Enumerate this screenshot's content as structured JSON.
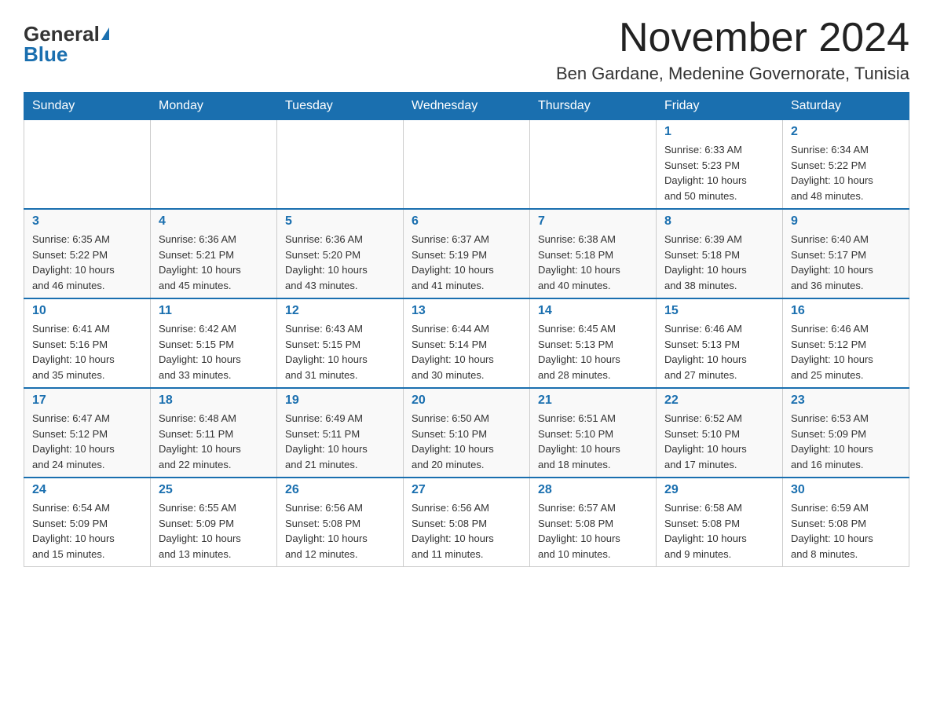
{
  "logo": {
    "general": "General",
    "blue": "Blue"
  },
  "title": "November 2024",
  "subtitle": "Ben Gardane, Medenine Governorate, Tunisia",
  "days_of_week": [
    "Sunday",
    "Monday",
    "Tuesday",
    "Wednesday",
    "Thursday",
    "Friday",
    "Saturday"
  ],
  "weeks": [
    [
      {
        "day": "",
        "info": ""
      },
      {
        "day": "",
        "info": ""
      },
      {
        "day": "",
        "info": ""
      },
      {
        "day": "",
        "info": ""
      },
      {
        "day": "",
        "info": ""
      },
      {
        "day": "1",
        "info": "Sunrise: 6:33 AM\nSunset: 5:23 PM\nDaylight: 10 hours\nand 50 minutes."
      },
      {
        "day": "2",
        "info": "Sunrise: 6:34 AM\nSunset: 5:22 PM\nDaylight: 10 hours\nand 48 minutes."
      }
    ],
    [
      {
        "day": "3",
        "info": "Sunrise: 6:35 AM\nSunset: 5:22 PM\nDaylight: 10 hours\nand 46 minutes."
      },
      {
        "day": "4",
        "info": "Sunrise: 6:36 AM\nSunset: 5:21 PM\nDaylight: 10 hours\nand 45 minutes."
      },
      {
        "day": "5",
        "info": "Sunrise: 6:36 AM\nSunset: 5:20 PM\nDaylight: 10 hours\nand 43 minutes."
      },
      {
        "day": "6",
        "info": "Sunrise: 6:37 AM\nSunset: 5:19 PM\nDaylight: 10 hours\nand 41 minutes."
      },
      {
        "day": "7",
        "info": "Sunrise: 6:38 AM\nSunset: 5:18 PM\nDaylight: 10 hours\nand 40 minutes."
      },
      {
        "day": "8",
        "info": "Sunrise: 6:39 AM\nSunset: 5:18 PM\nDaylight: 10 hours\nand 38 minutes."
      },
      {
        "day": "9",
        "info": "Sunrise: 6:40 AM\nSunset: 5:17 PM\nDaylight: 10 hours\nand 36 minutes."
      }
    ],
    [
      {
        "day": "10",
        "info": "Sunrise: 6:41 AM\nSunset: 5:16 PM\nDaylight: 10 hours\nand 35 minutes."
      },
      {
        "day": "11",
        "info": "Sunrise: 6:42 AM\nSunset: 5:15 PM\nDaylight: 10 hours\nand 33 minutes."
      },
      {
        "day": "12",
        "info": "Sunrise: 6:43 AM\nSunset: 5:15 PM\nDaylight: 10 hours\nand 31 minutes."
      },
      {
        "day": "13",
        "info": "Sunrise: 6:44 AM\nSunset: 5:14 PM\nDaylight: 10 hours\nand 30 minutes."
      },
      {
        "day": "14",
        "info": "Sunrise: 6:45 AM\nSunset: 5:13 PM\nDaylight: 10 hours\nand 28 minutes."
      },
      {
        "day": "15",
        "info": "Sunrise: 6:46 AM\nSunset: 5:13 PM\nDaylight: 10 hours\nand 27 minutes."
      },
      {
        "day": "16",
        "info": "Sunrise: 6:46 AM\nSunset: 5:12 PM\nDaylight: 10 hours\nand 25 minutes."
      }
    ],
    [
      {
        "day": "17",
        "info": "Sunrise: 6:47 AM\nSunset: 5:12 PM\nDaylight: 10 hours\nand 24 minutes."
      },
      {
        "day": "18",
        "info": "Sunrise: 6:48 AM\nSunset: 5:11 PM\nDaylight: 10 hours\nand 22 minutes."
      },
      {
        "day": "19",
        "info": "Sunrise: 6:49 AM\nSunset: 5:11 PM\nDaylight: 10 hours\nand 21 minutes."
      },
      {
        "day": "20",
        "info": "Sunrise: 6:50 AM\nSunset: 5:10 PM\nDaylight: 10 hours\nand 20 minutes."
      },
      {
        "day": "21",
        "info": "Sunrise: 6:51 AM\nSunset: 5:10 PM\nDaylight: 10 hours\nand 18 minutes."
      },
      {
        "day": "22",
        "info": "Sunrise: 6:52 AM\nSunset: 5:10 PM\nDaylight: 10 hours\nand 17 minutes."
      },
      {
        "day": "23",
        "info": "Sunrise: 6:53 AM\nSunset: 5:09 PM\nDaylight: 10 hours\nand 16 minutes."
      }
    ],
    [
      {
        "day": "24",
        "info": "Sunrise: 6:54 AM\nSunset: 5:09 PM\nDaylight: 10 hours\nand 15 minutes."
      },
      {
        "day": "25",
        "info": "Sunrise: 6:55 AM\nSunset: 5:09 PM\nDaylight: 10 hours\nand 13 minutes."
      },
      {
        "day": "26",
        "info": "Sunrise: 6:56 AM\nSunset: 5:08 PM\nDaylight: 10 hours\nand 12 minutes."
      },
      {
        "day": "27",
        "info": "Sunrise: 6:56 AM\nSunset: 5:08 PM\nDaylight: 10 hours\nand 11 minutes."
      },
      {
        "day": "28",
        "info": "Sunrise: 6:57 AM\nSunset: 5:08 PM\nDaylight: 10 hours\nand 10 minutes."
      },
      {
        "day": "29",
        "info": "Sunrise: 6:58 AM\nSunset: 5:08 PM\nDaylight: 10 hours\nand 9 minutes."
      },
      {
        "day": "30",
        "info": "Sunrise: 6:59 AM\nSunset: 5:08 PM\nDaylight: 10 hours\nand 8 minutes."
      }
    ]
  ]
}
